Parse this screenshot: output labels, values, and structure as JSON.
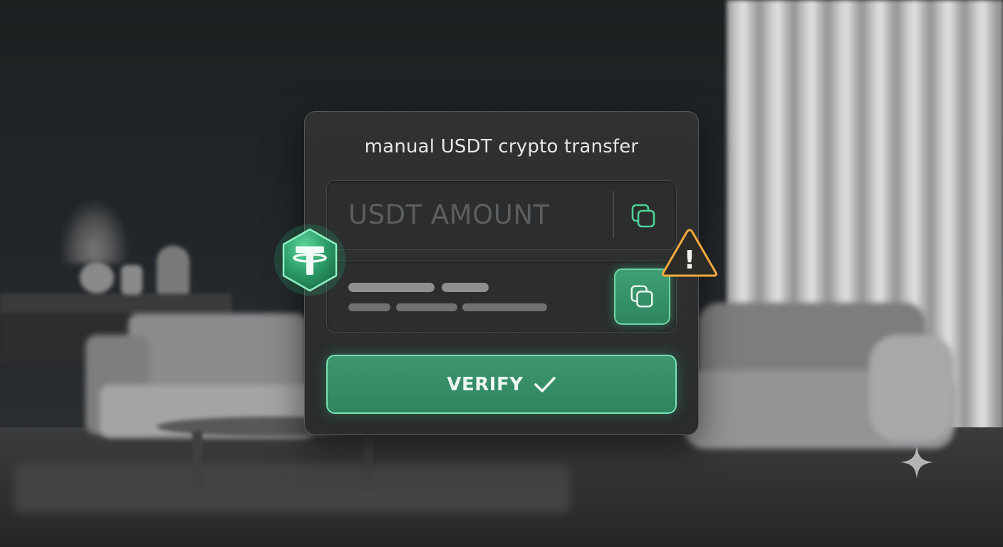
{
  "card": {
    "title": "manual USDT crypto transfer",
    "amount_field": {
      "placeholder": "USDT AMOUNT",
      "copy_icon": "copy-icon"
    },
    "address_field": {
      "copy_icon": "copy-icon",
      "content": "redacted"
    },
    "verify_button": {
      "label": "VERIFY",
      "icon": "checkmark-icon"
    }
  },
  "badges": {
    "tether": {
      "icon": "tether-logo",
      "glyph": "T"
    },
    "warning": {
      "icon": "warning-icon",
      "glyph": "!"
    }
  },
  "colors": {
    "accent": "#3d9670",
    "accent_border": "#78e0b0",
    "warning": "#f2a23a",
    "card_bg": "#2c2e2f"
  }
}
